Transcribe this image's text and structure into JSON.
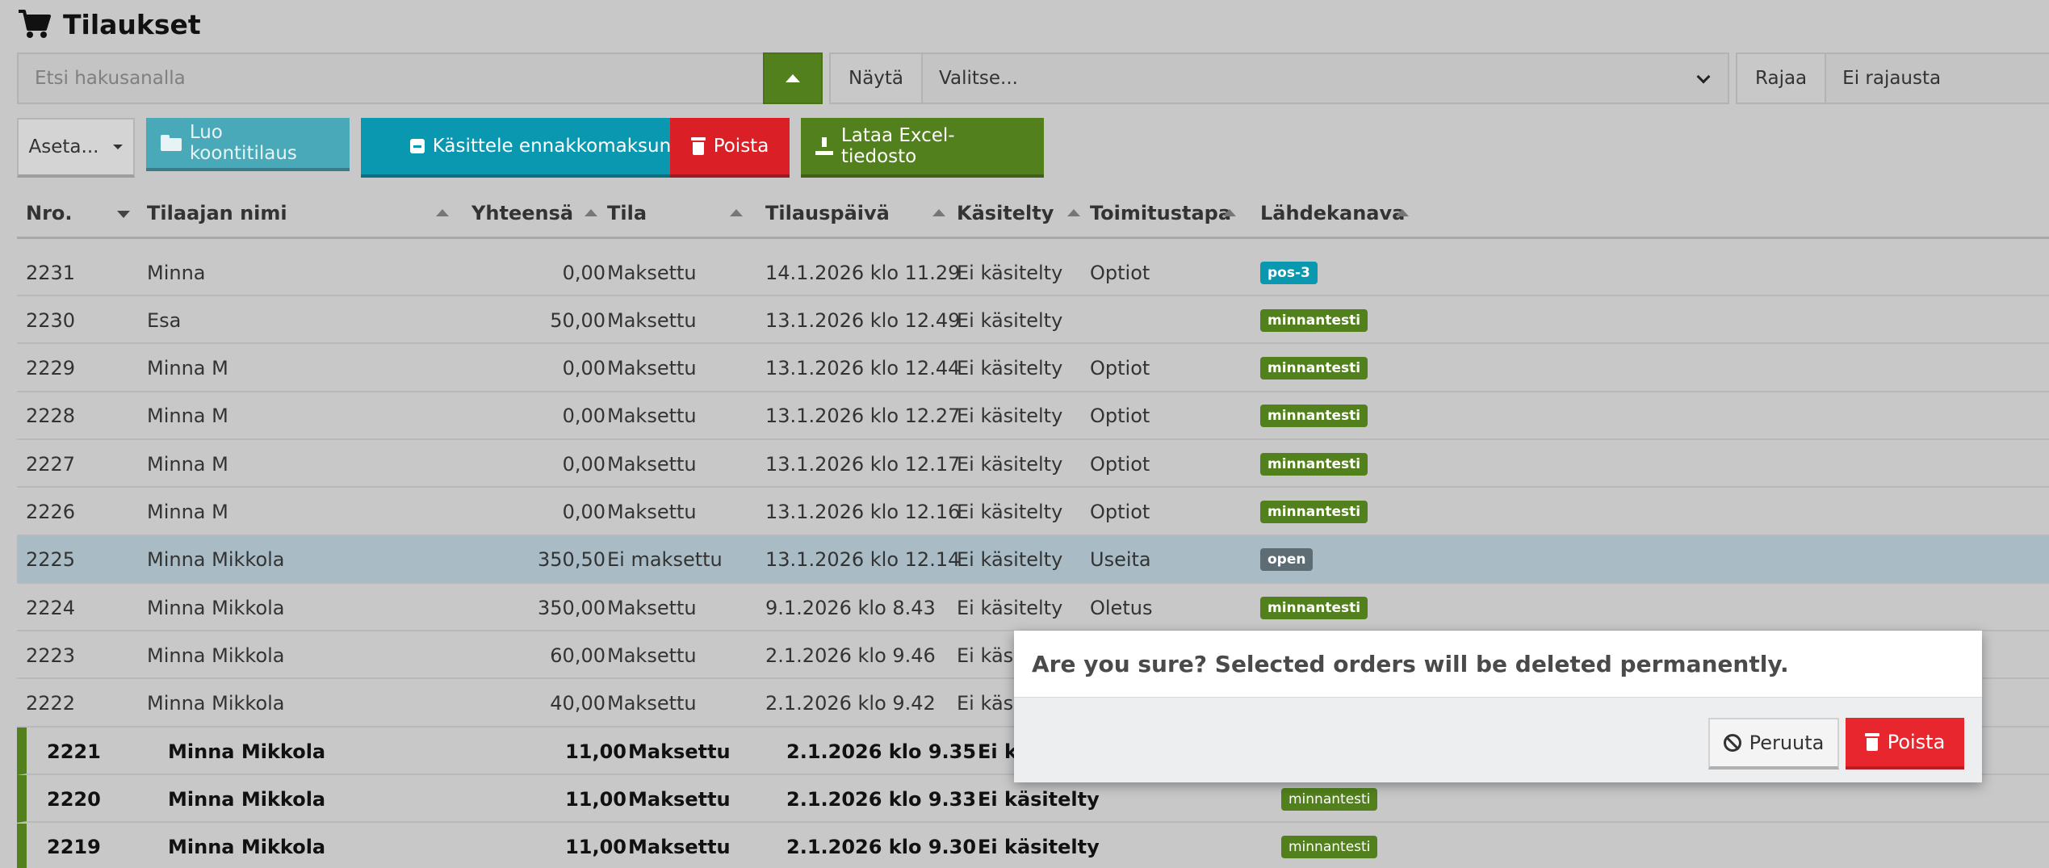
{
  "page": {
    "title": "Tilaukset"
  },
  "filters": {
    "search_placeholder": "Etsi hakusanalla",
    "show_label": "Näytä",
    "show_value": "Valitse...",
    "limit_label": "Rajaa",
    "limit_value": "Ei rajausta"
  },
  "toolbar": {
    "settings": "Aseta...",
    "consolidate": "Luo koontitilaus",
    "prepayment": "Käsittele ennakkomaksuna",
    "delete": "Poista",
    "excel": "Lataa Excel-tiedosto"
  },
  "columns": {
    "nro": "Nro.",
    "customer": "Tilaajan nimi",
    "total": "Yhteensä",
    "status": "Tila",
    "date": "Tilauspäivä",
    "handled": "Käsitelty",
    "delivery": "Toimitustapa",
    "source": "Lähdekanava"
  },
  "rows": [
    {
      "nro": "2231",
      "customer": "Minna",
      "total": "0,00",
      "status": "Maksettu",
      "date": "14.1.2026 klo 11.29",
      "handled": "Ei käsitelty",
      "delivery": "Optiot",
      "source": "pos-3",
      "source_color": "#0a97b0"
    },
    {
      "nro": "2230",
      "customer": "Esa",
      "total": "50,00",
      "status": "Maksettu",
      "date": "13.1.2026 klo 12.49",
      "handled": "Ei käsitelty",
      "delivery": "",
      "source": "minnantesti",
      "source_color": "#52801c"
    },
    {
      "nro": "2229",
      "customer": "Minna M",
      "total": "0,00",
      "status": "Maksettu",
      "date": "13.1.2026 klo 12.44",
      "handled": "Ei käsitelty",
      "delivery": "Optiot",
      "source": "minnantesti",
      "source_color": "#52801c"
    },
    {
      "nro": "2228",
      "customer": "Minna M",
      "total": "0,00",
      "status": "Maksettu",
      "date": "13.1.2026 klo 12.27",
      "handled": "Ei käsitelty",
      "delivery": "Optiot",
      "source": "minnantesti",
      "source_color": "#52801c"
    },
    {
      "nro": "2227",
      "customer": "Minna M",
      "total": "0,00",
      "status": "Maksettu",
      "date": "13.1.2026 klo 12.17",
      "handled": "Ei käsitelty",
      "delivery": "Optiot",
      "source": "minnantesti",
      "source_color": "#52801c"
    },
    {
      "nro": "2226",
      "customer": "Minna M",
      "total": "0,00",
      "status": "Maksettu",
      "date": "13.1.2026 klo 12.16",
      "handled": "Ei käsitelty",
      "delivery": "Optiot",
      "source": "minnantesti",
      "source_color": "#52801c"
    },
    {
      "nro": "2225",
      "customer": "Minna Mikkola",
      "total": "350,50",
      "status": "Ei maksettu",
      "date": "13.1.2026 klo 12.14",
      "handled": "Ei käsitelty",
      "delivery": "Useita",
      "source": "open",
      "source_color": "#5e6c73"
    },
    {
      "nro": "2224",
      "customer": "Minna Mikkola",
      "total": "350,00",
      "status": "Maksettu",
      "date": "9.1.2026 klo 8.43",
      "handled": "Ei käsitelty",
      "delivery": "Oletus",
      "source": "minnantesti",
      "source_color": "#52801c"
    },
    {
      "nro": "2223",
      "customer": "Minna Mikkola",
      "total": "60,00",
      "status": "Maksettu",
      "date": "2.1.2026 klo 9.46",
      "handled": "Ei käsi",
      "delivery": "",
      "source": "",
      "source_color": "#52801c"
    },
    {
      "nro": "2222",
      "customer": "Minna Mikkola",
      "total": "40,00",
      "status": "Maksettu",
      "date": "2.1.2026 klo 9.42",
      "handled": "Ei käsi",
      "delivery": "",
      "source": "",
      "source_color": "#52801c"
    },
    {
      "nro": "2221",
      "customer": "Minna Mikkola",
      "total": "11,00",
      "status": "Maksettu",
      "date": "2.1.2026 klo 9.35",
      "handled": "Ei k",
      "delivery": "",
      "source": "",
      "source_color": "#52801c"
    },
    {
      "nro": "2220",
      "customer": "Minna Mikkola",
      "total": "11,00",
      "status": "Maksettu",
      "date": "2.1.2026 klo 9.33",
      "handled": "Ei käsitelty",
      "delivery": "",
      "source": "minnantesti",
      "source_color": "#52801c"
    },
    {
      "nro": "2219",
      "customer": "Minna Mikkola",
      "total": "11,00",
      "status": "Maksettu",
      "date": "2.1.2026 klo 9.30",
      "handled": "Ei käsitelty",
      "delivery": "",
      "source": "minnantesti",
      "source_color": "#52801c"
    }
  ],
  "modal": {
    "message": "Are you sure? Selected orders will be deleted permanently.",
    "cancel": "Peruuta",
    "delete": "Poista"
  }
}
